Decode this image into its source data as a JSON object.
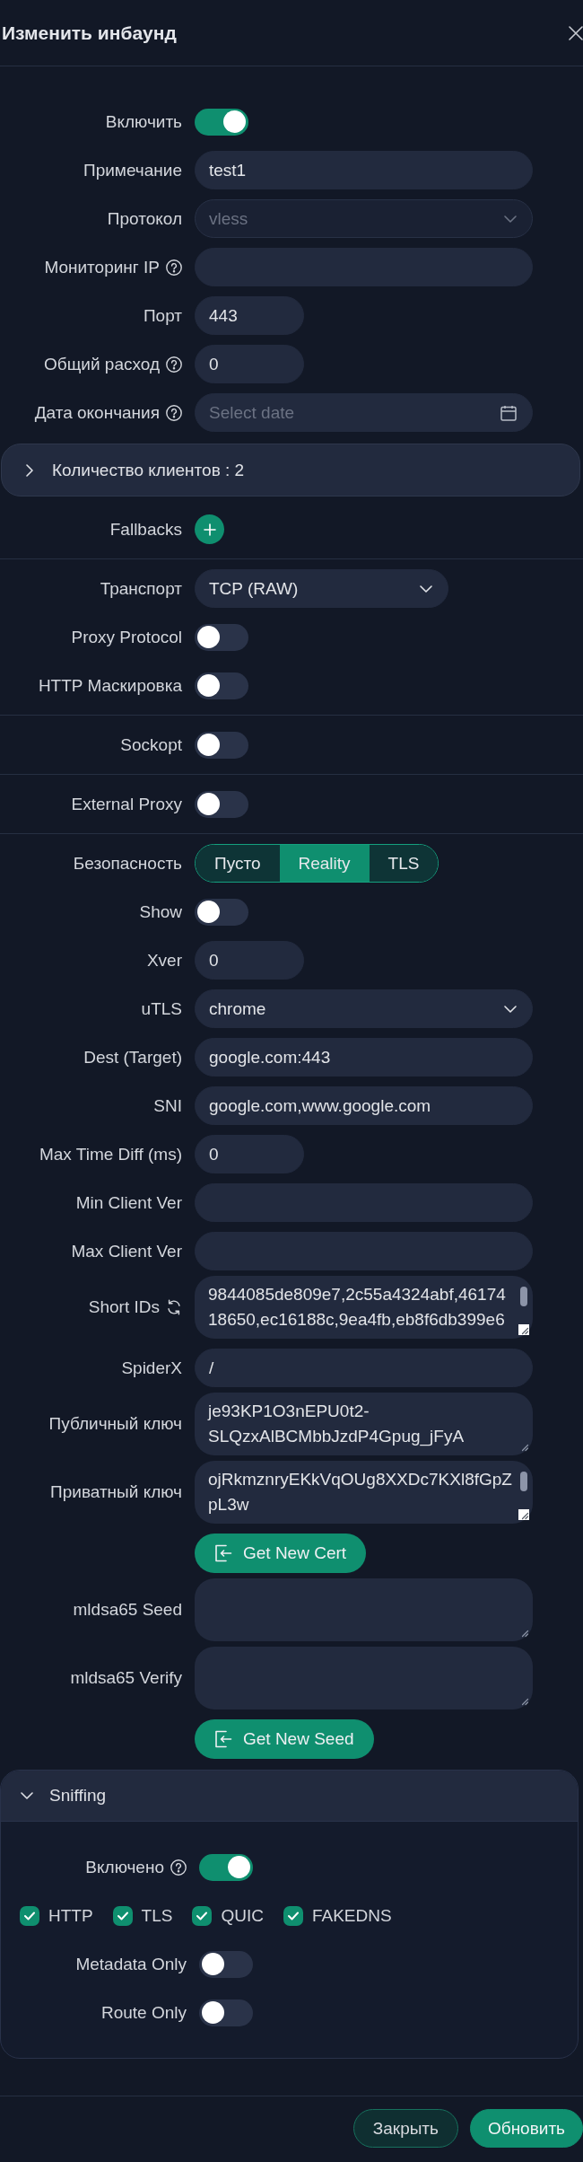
{
  "modal": {
    "title": "Изменить инбаунд"
  },
  "sections": [
    {
      "rows": [
        {
          "kind": "switch",
          "label": "Включить",
          "on": true
        },
        {
          "kind": "input",
          "label": "Примечание",
          "value": "test1"
        },
        {
          "kind": "select",
          "label": "Протокол",
          "value": "vless",
          "disabled": true
        },
        {
          "kind": "input",
          "label": "Мониторинг IP",
          "help": true
        },
        {
          "kind": "number",
          "label": "Порт",
          "value": "443"
        },
        {
          "kind": "number",
          "label": "Общий расход",
          "help": true,
          "value": "0"
        },
        {
          "kind": "date",
          "label": "Дата окончания",
          "help": true,
          "placeholder": "Select date"
        },
        {
          "kind": "collapse",
          "title": "Количество клиентов : 2",
          "expanded": false
        },
        {
          "kind": "add",
          "label": "Fallbacks"
        }
      ]
    },
    {
      "rows": [
        {
          "kind": "dropdown",
          "label": "Транспорт",
          "value": "TCP (RAW)",
          "disabled": false
        },
        {
          "kind": "switch",
          "label": "Proxy Protocol",
          "on": false
        },
        {
          "kind": "switch",
          "label": "HTTP Маскировка",
          "on": false
        }
      ]
    },
    {
      "rows": [
        {
          "kind": "switch",
          "label": "Sockopt",
          "on": false
        }
      ]
    },
    {
      "rows": [
        {
          "kind": "switch",
          "label": "External Proxy",
          "on": false
        }
      ]
    },
    {
      "rows": [
        {
          "kind": "segmented",
          "label": "Безопасность",
          "options": [
            {
              "label": "Пусто",
              "selected": false
            },
            {
              "label": "Reality",
              "selected": true
            },
            {
              "label": "TLS",
              "selected": false
            }
          ]
        },
        {
          "kind": "switch",
          "label": "Show",
          "on": false
        },
        {
          "kind": "number",
          "label": "Xver",
          "value": "0"
        },
        {
          "kind": "select",
          "label": "uTLS",
          "value": "chrome",
          "disabled": false
        },
        {
          "kind": "input",
          "label": "Dest (Target)",
          "value": "google.com:443"
        },
        {
          "kind": "input",
          "label": "SNI",
          "value": "google.com,www.google.com"
        },
        {
          "kind": "number",
          "label": "Max Time Diff (ms)",
          "value": "0"
        },
        {
          "kind": "input",
          "label": "Min Client Ver"
        },
        {
          "kind": "input",
          "label": "Max Client Ver"
        },
        {
          "kind": "textarea",
          "label": "Short IDs",
          "regenerate": true,
          "value": "9844085de809e7,2c55a4324abf,4617418650,ec16188c,9ea4fb,eb8f6db399e6",
          "scrollbar": true
        },
        {
          "kind": "input",
          "label": "SpiderX",
          "value": "/"
        },
        {
          "kind": "textarea",
          "label": "Публичный ключ",
          "value": "je93KP1O3nEPU0t2-SLQzxAlBCMbbJzdP4Gpug_jFyA",
          "scrollbar": false
        },
        {
          "kind": "textarea",
          "label": "Приватный ключ",
          "value": "ojRkmznryEKkVqOUg8XXDc7KXl8fGpZpL3w",
          "scrollbar": true
        },
        {
          "kind": "button",
          "label": "Get New Cert"
        },
        {
          "kind": "textarea",
          "label": "mldsa65 Seed",
          "scrollbar": false
        },
        {
          "kind": "textarea",
          "label": "mldsa65 Verify",
          "scrollbar": false
        },
        {
          "kind": "button",
          "label": "Get New Seed"
        },
        {
          "kind": "panel",
          "title": "Sniffing",
          "expanded": true,
          "rows": [
            {
              "kind": "switch",
              "label": "Включено",
              "help": true,
              "on": true
            },
            {
              "kind": "checkboxes",
              "items": [
                {
                  "label": "HTTP",
                  "checked": true
                },
                {
                  "label": "TLS",
                  "checked": true
                },
                {
                  "label": "QUIC",
                  "checked": true
                },
                {
                  "label": "FAKEDNS",
                  "checked": true
                }
              ]
            },
            {
              "kind": "switch",
              "label": "Metadata Only",
              "on": false
            },
            {
              "kind": "switch",
              "label": "Route Only",
              "on": false
            }
          ]
        }
      ]
    }
  ],
  "footer": {
    "buttons": [
      {
        "kind": "secondary",
        "label": "Закрыть"
      },
      {
        "kind": "primary",
        "label": "Обновить"
      }
    ]
  }
}
